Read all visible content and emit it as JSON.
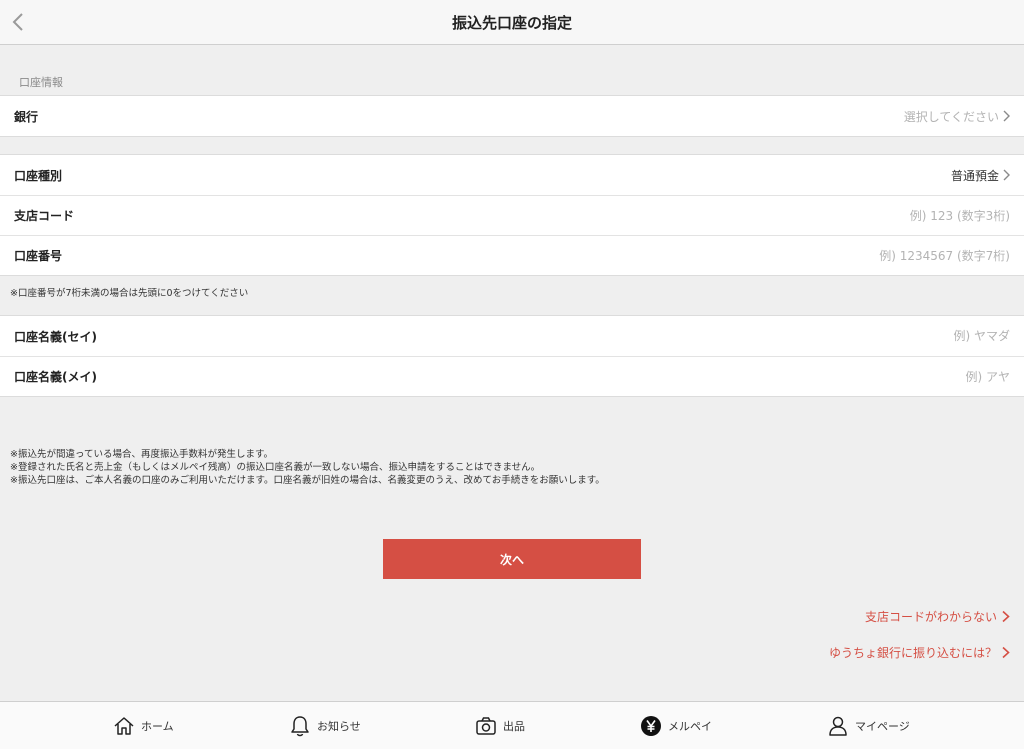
{
  "navbar": {
    "title": "振込先口座の指定"
  },
  "account_info": {
    "section_label": "口座情報",
    "bank": {
      "label": "銀行",
      "placeholder": "選択してください"
    },
    "account_type": {
      "label": "口座種別",
      "value": "普通預金"
    },
    "branch_code": {
      "label": "支店コード",
      "placeholder": "例) 123 (数字3桁)"
    },
    "account_number": {
      "label": "口座番号",
      "placeholder": "例) 1234567 (数字7桁)"
    },
    "account_number_note": "※口座番号が7桁未満の場合は先頭に0をつけてください",
    "name_kana_sei": {
      "label": "口座名義(セイ)",
      "placeholder": "例) ヤマダ"
    },
    "name_kana_mei": {
      "label": "口座名義(メイ)",
      "placeholder": "例) アヤ"
    }
  },
  "notes": [
    "※振込先が間違っている場合、再度振込手数料が発生します。",
    "※登録された氏名と売上金（もしくはメルペイ残高）の振込口座名義が一致しない場合、振込申請をすることはできません。",
    "※振込先口座は、ご本人名義の口座のみご利用いただけます。口座名義が旧姓の場合は、名義変更のうえ、改めてお手続きをお願いします。"
  ],
  "next_button": {
    "label": "次へ"
  },
  "links": {
    "branch_code_unknown": "支店コードがわからない",
    "yucho_transfer": "ゆうちょ銀行に振り込むには？"
  },
  "tabbar": {
    "items": [
      {
        "label": "ホーム",
        "icon": "home-icon"
      },
      {
        "label": "お知らせ",
        "icon": "bell-icon"
      },
      {
        "label": "出品",
        "icon": "camera-icon"
      },
      {
        "label": "メルペイ",
        "icon": "yen-icon"
      },
      {
        "label": "マイページ",
        "icon": "person-icon"
      }
    ]
  },
  "colors": {
    "accent": "#d54f44",
    "background": "#efefef"
  }
}
